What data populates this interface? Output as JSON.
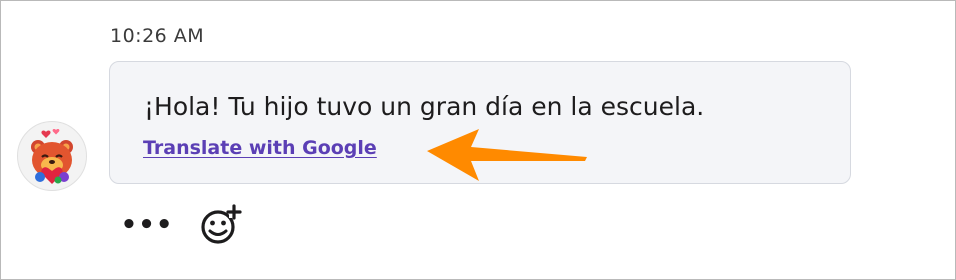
{
  "message": {
    "timestamp": "10:26 AM",
    "text": "¡Hola! Tu hijo tuvo un gran día en la escuela.",
    "translate_label": "Translate with Google"
  },
  "actions": {
    "more_label": "•••"
  },
  "icons": {
    "avatar": "bear-with-hearts-avatar",
    "arrow": "arrow-left-icon",
    "more": "more-dots-icon",
    "react": "add-reaction-icon"
  },
  "colors": {
    "link": "#5b3fb5",
    "arrow": "#ff8a00",
    "bubble_bg": "#f4f5f8",
    "bubble_border": "#d6d9e0"
  }
}
